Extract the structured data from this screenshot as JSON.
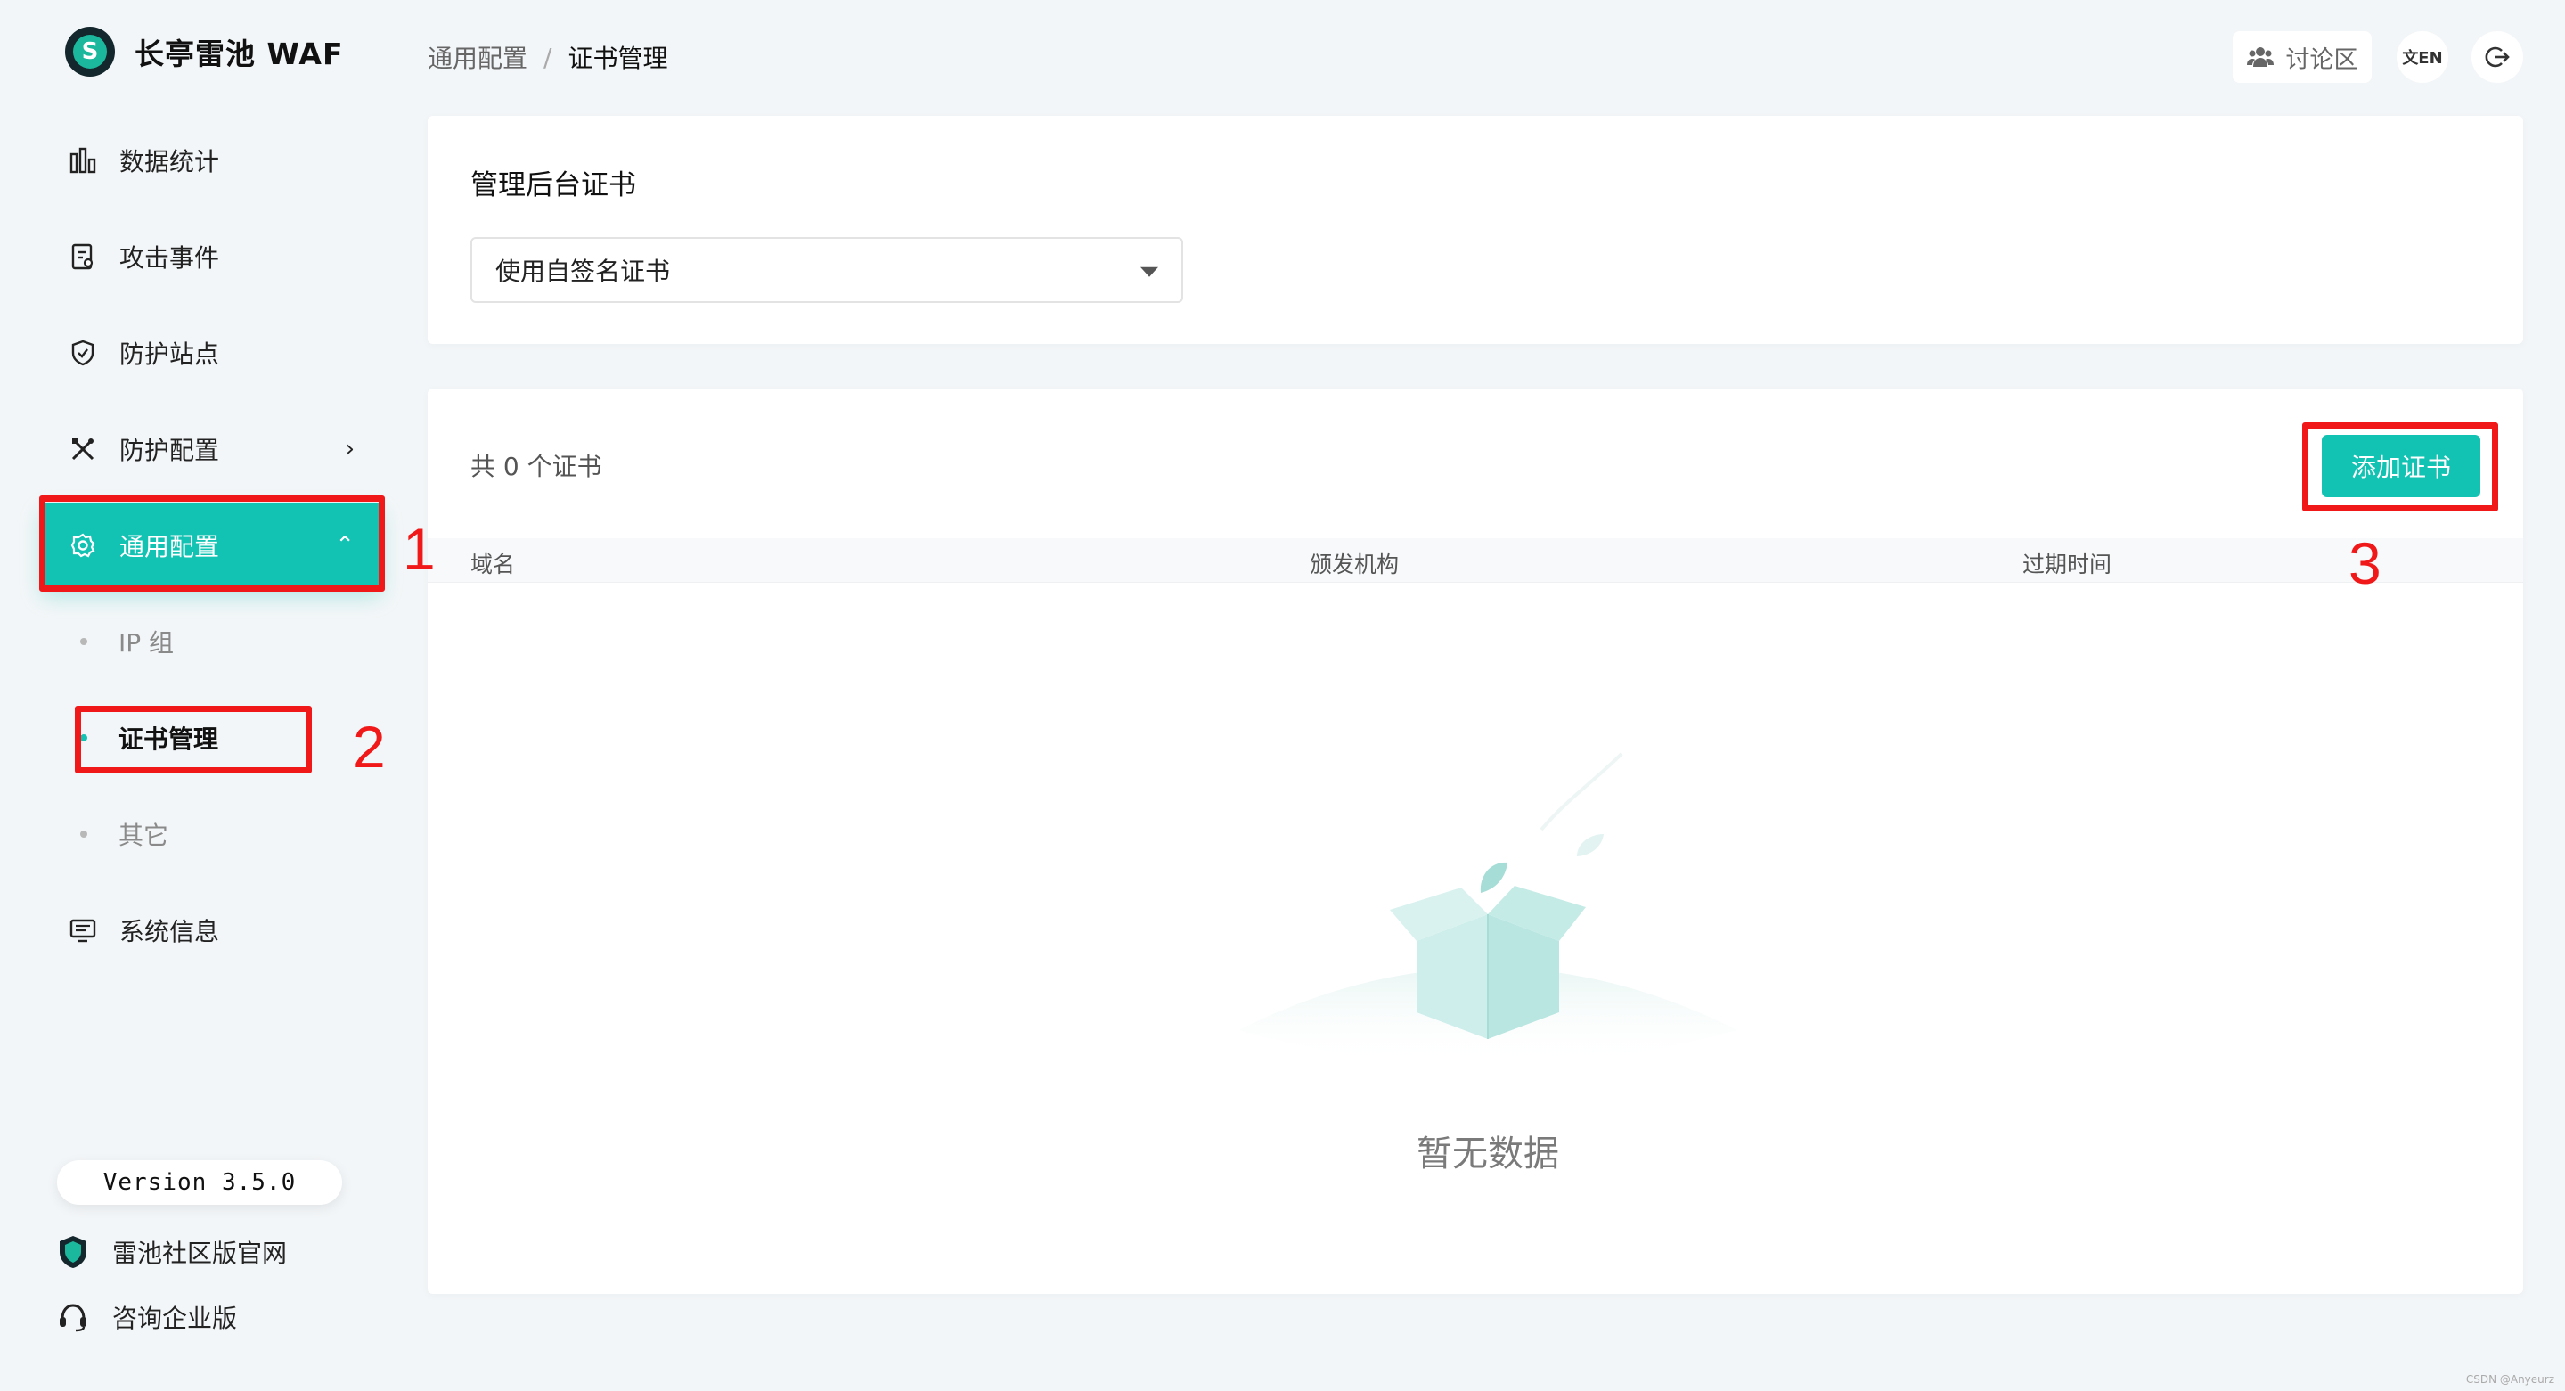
{
  "brand": {
    "name": "长亭雷池 WAF",
    "logo_letter": "S"
  },
  "sidebar": {
    "items": [
      {
        "label": "数据统计",
        "icon": "bar-chart-icon"
      },
      {
        "label": "攻击事件",
        "icon": "document-icon"
      },
      {
        "label": "防护站点",
        "icon": "shield-icon"
      },
      {
        "label": "防护配置",
        "icon": "tools-icon",
        "chevron": "›"
      },
      {
        "label": "通用配置",
        "icon": "gear-icon",
        "chevron": "⌃",
        "active": true
      },
      {
        "label": "系统信息",
        "icon": "monitor-icon"
      }
    ],
    "sub_items": [
      {
        "label": "IP 组"
      },
      {
        "label": "证书管理",
        "active": true
      },
      {
        "label": "其它"
      }
    ],
    "version": "Version 3.5.0",
    "footer_links": [
      {
        "label": "雷池社区版官网",
        "icon": "shield-logo-icon"
      },
      {
        "label": "咨询企业版",
        "icon": "headset-icon"
      }
    ]
  },
  "header": {
    "breadcrumb": {
      "parent": "通用配置",
      "separator": "/",
      "current": "证书管理"
    },
    "forum_label": "讨论区",
    "lang_label": "文EN"
  },
  "admin_cert": {
    "title": "管理后台证书",
    "select_value": "使用自签名证书"
  },
  "cert_list": {
    "count_text": "共 0 个证书",
    "add_button": "添加证书",
    "columns": [
      "域名",
      "颁发机构",
      "过期时间"
    ],
    "empty_text": "暂无数据"
  },
  "annotations": [
    "1",
    "2",
    "3"
  ],
  "watermark": "CSDN @Anyeurz",
  "colors": {
    "accent": "#12c2b2",
    "annotation": "#f01818",
    "background": "#f3f6f8"
  }
}
